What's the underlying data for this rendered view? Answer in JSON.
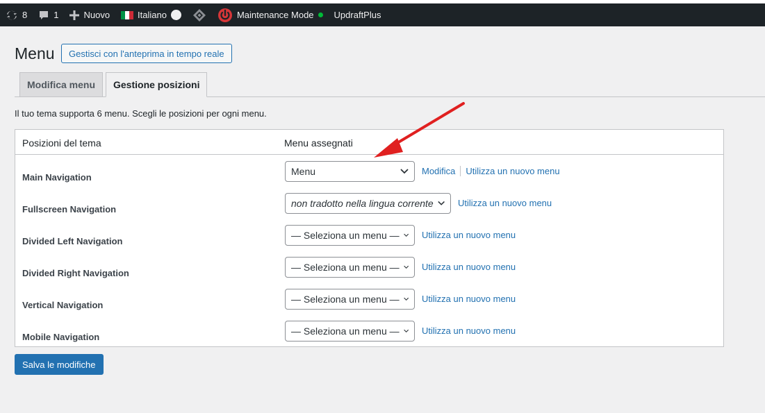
{
  "adminbar": {
    "updates_count": "8",
    "comments_count": "1",
    "new_label": "Nuovo",
    "language_label": "Italiano",
    "help_badge": "?",
    "maintenance_label": "Maintenance Mode",
    "updraft_label": "UpdraftPlus",
    "status_color": "#00ba37"
  },
  "header": {
    "title": "Menu",
    "live_preview_button": "Gestisci con l'anteprima in tempo reale"
  },
  "tabs": [
    {
      "label": "Modifica menu",
      "active": false
    },
    {
      "label": "Gestione posizioni",
      "active": true
    }
  ],
  "description": "Il tuo tema supporta 6 menu. Scegli le posizioni per ogni menu.",
  "table": {
    "headers": [
      "Posizioni del tema",
      "Menu assegnati"
    ],
    "rows": [
      {
        "location": "Main Navigation",
        "selected": "Menu",
        "links": [
          "Modifica",
          "Utilizza un nuovo menu"
        ]
      },
      {
        "location": "Fullscreen Navigation",
        "selected": "non tradotto nella lingua corrente",
        "links": [
          "Utilizza un nuovo menu"
        ]
      },
      {
        "location": "Divided Left Navigation",
        "selected": "— Seleziona un menu —",
        "links": [
          "Utilizza un nuovo menu"
        ]
      },
      {
        "location": "Divided Right Navigation",
        "selected": "— Seleziona un menu —",
        "links": [
          "Utilizza un nuovo menu"
        ]
      },
      {
        "location": "Vertical Navigation",
        "selected": "— Seleziona un menu —",
        "links": [
          "Utilizza un nuovo menu"
        ]
      },
      {
        "location": "Mobile Navigation",
        "selected": "— Seleziona un menu —",
        "links": [
          "Utilizza un nuovo menu"
        ]
      }
    ]
  },
  "save_button": "Salva le modifiche",
  "colors": {
    "accent": "#2271b1",
    "annotation_arrow": "#e02020"
  }
}
